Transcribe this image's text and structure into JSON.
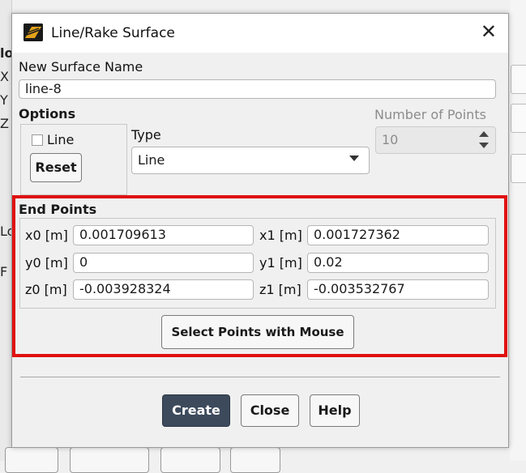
{
  "window": {
    "title": "Line/Rake Surface",
    "icon": "app-logo-icon",
    "close_glyph": "✕"
  },
  "surface_name": {
    "label": "New Surface Name",
    "value": "line-8"
  },
  "options": {
    "label": "Options",
    "line_checkbox_label": "Line",
    "line_checked": false,
    "reset_label": "Reset"
  },
  "type": {
    "label": "Type",
    "selected": "Line"
  },
  "number_of_points": {
    "label": "Number of Points",
    "value": "10"
  },
  "end_points": {
    "label": "End Points",
    "x0": {
      "label": "x0 [m]",
      "value": "0.001709613"
    },
    "y0": {
      "label": "y0 [m]",
      "value": "0"
    },
    "z0": {
      "label": "z0 [m]",
      "value": "-0.003928324"
    },
    "x1": {
      "label": "x1 [m]",
      "value": "0.001727362"
    },
    "y1": {
      "label": "y1 [m]",
      "value": "0.02"
    },
    "z1": {
      "label": "z1 [m]",
      "value": "-0.003532767"
    },
    "select_mouse_label": "Select Points with Mouse"
  },
  "buttons": {
    "create": "Create",
    "close": "Close",
    "help": "Help"
  },
  "background": {
    "letters": [
      "lo",
      "X",
      "Y",
      "Z",
      "Lo",
      "F"
    ]
  },
  "colors": {
    "highlight": "#e01010",
    "primary_button": "#3c4a5c"
  }
}
